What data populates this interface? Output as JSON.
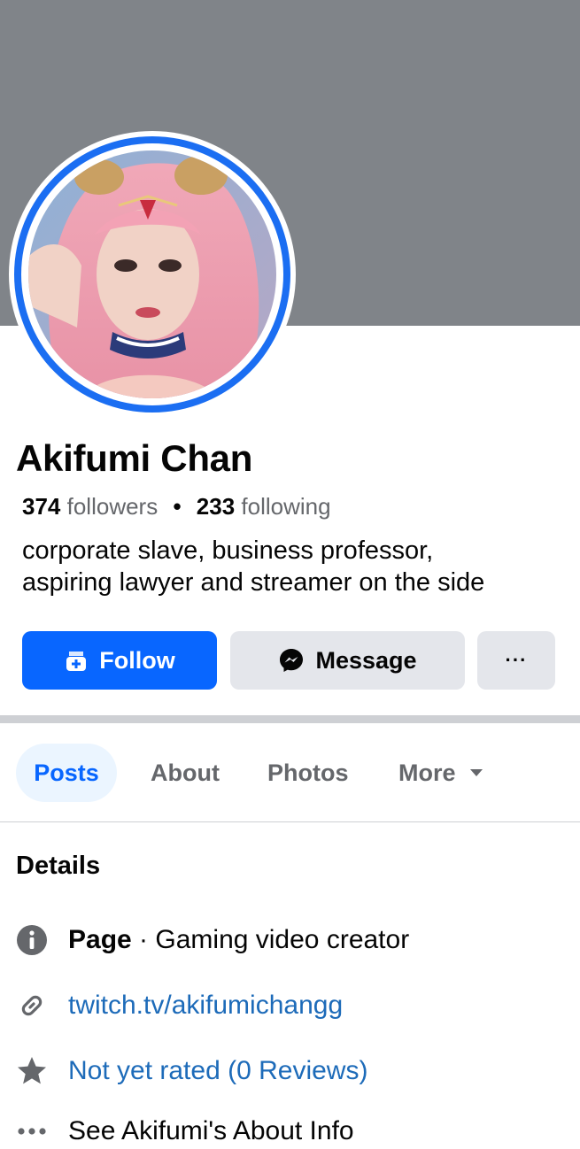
{
  "profile": {
    "name": "Akifumi Chan",
    "followers_count": "374",
    "followers_label": "followers",
    "separator": "•",
    "following_count": "233",
    "following_label": "following",
    "bio_line1": "corporate slave, business professor,",
    "bio_line2": "aspiring lawyer and streamer on the side"
  },
  "actions": {
    "follow_label": "Follow",
    "message_label": "Message",
    "more_label": "···"
  },
  "tabs": [
    {
      "label": "Posts",
      "active": true
    },
    {
      "label": "About",
      "active": false
    },
    {
      "label": "Photos",
      "active": false
    },
    {
      "label": "More",
      "active": false
    }
  ],
  "details": {
    "heading": "Details",
    "page_label": "Page",
    "page_sep": " · ",
    "page_category": "Gaming video creator",
    "link": "twitch.tv/akifumichangg",
    "rating": "Not yet rated (0 Reviews)",
    "see_about": "See Akifumi's About Info"
  },
  "icons": {
    "follow": "add-follow-icon",
    "message": "messenger-icon",
    "more": "more-options-icon",
    "caret": "caret-down-icon",
    "info": "info-icon",
    "link": "link-icon",
    "star": "star-icon",
    "dots": "dots-icon"
  },
  "colors": {
    "accent": "#0866ff",
    "cover": "#808489",
    "ring": "#1b6ef2",
    "link": "#1d6bb9",
    "secondary_text": "#65676b",
    "button_gray": "#e4e6eb"
  }
}
